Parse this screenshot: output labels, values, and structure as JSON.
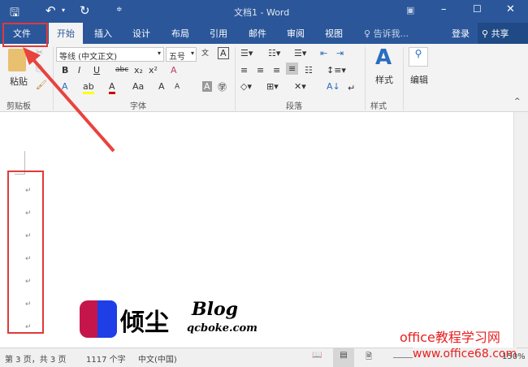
{
  "title": {
    "doc_title": "文档1 - Word"
  },
  "tabs": [
    {
      "label": "文件"
    },
    {
      "label": "开始"
    },
    {
      "label": "插入"
    },
    {
      "label": "设计"
    },
    {
      "label": "布局"
    },
    {
      "label": "引用"
    },
    {
      "label": "邮件"
    },
    {
      "label": "审阅"
    },
    {
      "label": "视图"
    }
  ],
  "tell_me": "告诉我...",
  "login": "登录",
  "share": "共享",
  "ribbon": {
    "paste": "粘贴",
    "clipboard": "剪贴板",
    "font_name": "等线 (中文正文)",
    "font_size": "五号",
    "font_group": "字体",
    "paragraph_group": "段落",
    "styles": "样式",
    "styles_group": "样式",
    "editing": "编辑",
    "bold": "B",
    "italic": "I",
    "underline": "U",
    "strike": "abc",
    "sub": "x₂",
    "sup": "x²",
    "grow": "A",
    "case": "Aa"
  },
  "para_mark": "↵",
  "watermark": {
    "brand": "倾尘",
    "blog": "Blog",
    "site": "qcboke.com",
    "office_text": "office教程学习网",
    "office_url": "www.office68.com"
  },
  "status": {
    "page": "第 3 页，共 3 页",
    "words": "1117 个字",
    "lang": "中文(中国)",
    "zoom": "150%"
  }
}
